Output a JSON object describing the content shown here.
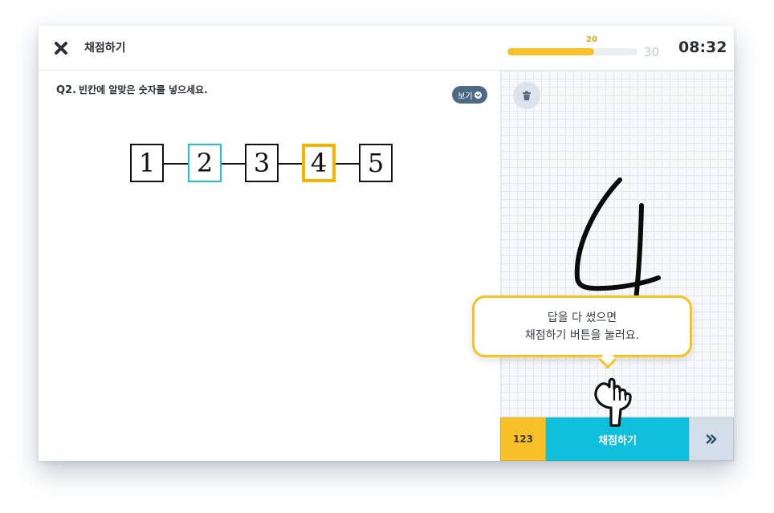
{
  "header": {
    "close_icon": "close-x-icon",
    "title": "채점하기",
    "progress": {
      "current": "20",
      "total": "30",
      "fraction": 0.667,
      "accent": "#f7c12b"
    },
    "timer": "08:32"
  },
  "question": {
    "number": "Q2.",
    "text": "빈칸에 알맞은 숫자를 넣으세요.",
    "view_button": "보기",
    "boxes": [
      "1",
      "2",
      "3",
      "4",
      "5"
    ],
    "highlight_colors": {
      "box2": "#1ec0dc",
      "box4": "#f6b400"
    }
  },
  "draw_pad": {
    "trash_icon": "trash-icon",
    "handwritten_answer": "4"
  },
  "tooltip": {
    "line1": "답을 다 썼으면",
    "line2": "채점하기 버튼을 눌러요."
  },
  "bottom_bar": {
    "numpad_label": "123",
    "grade_label": "채점하기",
    "next_icon": "double-chevron-right-icon"
  }
}
